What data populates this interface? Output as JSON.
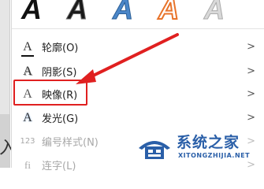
{
  "gallery": {
    "samples": [
      "A",
      "A",
      "A",
      "A",
      "A"
    ]
  },
  "menu": {
    "items": [
      {
        "label": "轮廓(O)",
        "icon": "outline-icon",
        "disabled": false
      },
      {
        "label": "阴影(S)",
        "icon": "shadow-icon",
        "disabled": false
      },
      {
        "label": "映像(R)",
        "icon": "reflection-icon",
        "disabled": false,
        "highlighted": true
      },
      {
        "label": "发光(G)",
        "icon": "glow-icon",
        "disabled": false
      },
      {
        "label": "编号样式(N)",
        "icon": "number-style-icon",
        "disabled": true
      },
      {
        "label": "连字(L)",
        "icon": "ligature-icon",
        "disabled": true
      }
    ],
    "chevron": ">"
  },
  "left_panel": {
    "visible_char": "入"
  },
  "annotation": {
    "box_color": "#e02020",
    "arrow_color": "#e02020"
  },
  "watermark": {
    "title": "系统之家",
    "subtitle": "XITONGZHIJIA.NET"
  }
}
